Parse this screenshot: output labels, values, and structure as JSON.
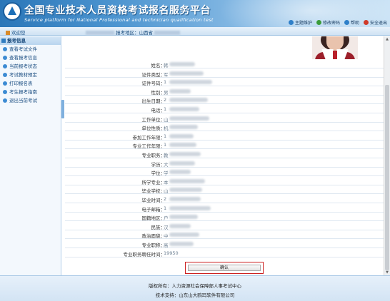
{
  "header": {
    "title_cn": "全国专业技术人员资格考试报名服务平台",
    "title_en": "Service platform for National Professional and technician qualification test"
  },
  "tools": [
    {
      "label": "主题维护",
      "icon": "theme-icon",
      "color": "#2f80c9"
    },
    {
      "label": "修改密码",
      "icon": "key-icon",
      "color": "#3a9c3a"
    },
    {
      "label": "帮助",
      "icon": "help-icon",
      "color": "#2f80c9"
    },
    {
      "label": "安全退出",
      "icon": "power-icon",
      "color": "#d03a2a"
    }
  ],
  "navbar": {
    "welcome": "欢迎您",
    "crumb_mid": "报考地区：",
    "crumb_region": "山西省"
  },
  "sidebar": {
    "heading": "报考信息",
    "items": [
      {
        "label": "查看考试文件"
      },
      {
        "label": "查看报考信息"
      },
      {
        "label": "当前报考状态"
      },
      {
        "label": "考试教材预定"
      },
      {
        "label": "打印报名表"
      },
      {
        "label": "考生报考指南"
      },
      {
        "label": "退出当前考试"
      }
    ]
  },
  "form": {
    "rows": [
      {
        "label": "姓名：",
        "value": "韩"
      },
      {
        "label": "证件类型：",
        "value": "军"
      },
      {
        "label": "证件号码：",
        "value": "1"
      },
      {
        "label": "性别：",
        "value": "男"
      },
      {
        "label": "出生日期：",
        "value": "2"
      },
      {
        "label": "电话：",
        "value": "1"
      },
      {
        "label": "工作单位：",
        "value": "山"
      },
      {
        "label": "单位性质：",
        "value": "机"
      },
      {
        "label": "参加工作年限：",
        "value": "1"
      },
      {
        "label": "专业工作年限：",
        "value": "1"
      },
      {
        "label": "专业职务：",
        "value": "教"
      },
      {
        "label": "学历：",
        "value": "大"
      },
      {
        "label": "学位：",
        "value": "学"
      },
      {
        "label": "所学专业：",
        "value": "本"
      },
      {
        "label": "毕业学校：",
        "value": "山"
      },
      {
        "label": "毕业时间：",
        "value": "2"
      },
      {
        "label": "电子邮箱：",
        "value": "1"
      },
      {
        "label": "国籍地区：",
        "value": "户"
      },
      {
        "label": "民族：",
        "value": "汉"
      },
      {
        "label": "政治面貌：",
        "value": "中"
      },
      {
        "label": "专业职称：",
        "value": "高"
      },
      {
        "label": "专业职务聘任时间：",
        "value": "19950"
      }
    ],
    "confirm_label": "确认"
  },
  "footer": {
    "copyright": "版权所有：人力资源社会保障部人事考试中心",
    "support": "技术支持：山东山大鸥玛软件有限公司"
  }
}
